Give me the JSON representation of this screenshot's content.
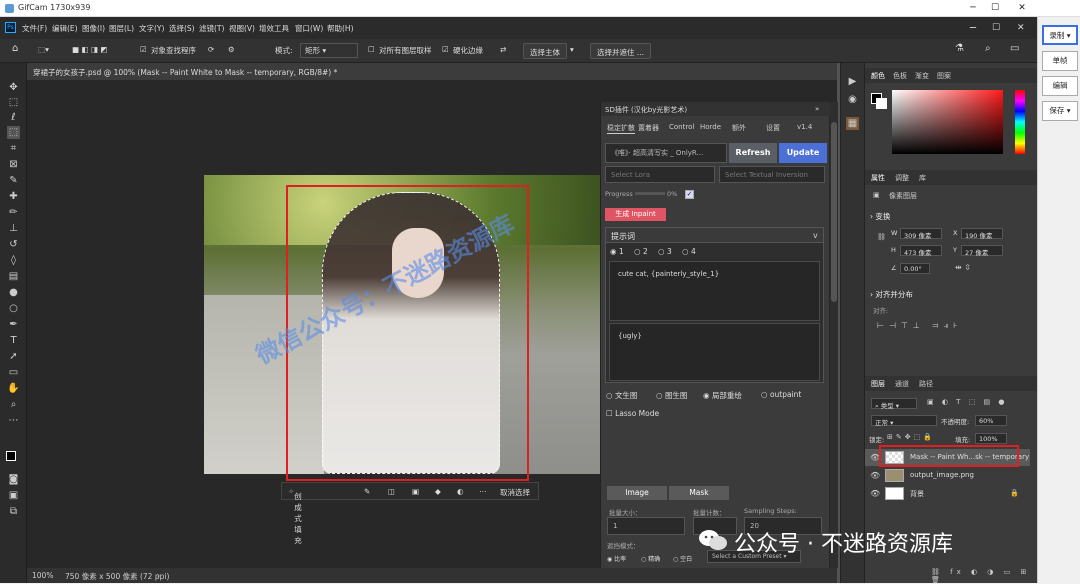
{
  "gifcam": {
    "title": "GifCam 1730x939",
    "buttons": [
      "录制",
      "单帧",
      "编辑",
      "保存"
    ]
  },
  "menu": [
    "文件(F)",
    "编辑(E)",
    "图像(I)",
    "图层(L)",
    "文字(Y)",
    "选择(S)",
    "滤镜(T)",
    "视图(V)",
    "增效工具",
    "窗口(W)",
    "帮助(H)"
  ],
  "options": {
    "auto_select": "对象查找程序",
    "mode_label": "模式:",
    "mode_value": "矩形",
    "sample_all": "对所有图层取样",
    "enhance": "硬化边缘",
    "select_subject": "选择主体",
    "select_and_mask": "选择并遮住 ..."
  },
  "document": {
    "tab": "穿裙子的女孩子.psd @ 100% (Mask -- Paint White to Mask -- temporary, RGB/8#) *",
    "zoom": "100%",
    "size": "750 像素 x 500 像素 (72 ppi)"
  },
  "watermark_canvas": "微信公众号：不迷路资源库",
  "contextbar": {
    "generate": "创成式填充",
    "deselect": "取消选择"
  },
  "sd": {
    "title": "SD插件 (汉化by光影艺术)",
    "tabs": [
      "稳定扩散",
      "置着器",
      "Control",
      "Horde",
      "额外",
      "设置",
      "v1.4"
    ],
    "model": "《唯》· 超高清写实 _ OnlyR...",
    "refresh": "Refresh",
    "update": "Update",
    "lora": "Select Lora",
    "embedding": "Select Textual Inversion",
    "progress_label": "Progress",
    "progress_pct": "0%",
    "generate": "生成 Inpaint",
    "prompt_header": "提示词",
    "prompt_tabs": [
      "1",
      "2",
      "3",
      "4"
    ],
    "prompt_text": "cute cat, {painterly_style_1}",
    "negative_text": "{ugly}",
    "modes": [
      "文生图",
      "图生图",
      "局部重绘",
      "outpaint"
    ],
    "lasso": "Lasso Mode",
    "image_btn": "Image",
    "mask_btn": "Mask",
    "batch_size_label": "批量大小：",
    "batch_size": "1",
    "batch_count_label": "批量计数：",
    "steps_label": "Sampling Steps:",
    "steps": "20",
    "mask_mode_label": "遮挡模式：",
    "mask_opts": [
      "比率",
      "精确",
      "空白"
    ],
    "preset": "Select a Custom Preset"
  },
  "right": {
    "color_tabs": [
      "颜色",
      "色板",
      "渐变",
      "图案"
    ],
    "props_tabs": [
      "属性",
      "调整",
      "库"
    ],
    "pixel_layer": "像素图层",
    "transform": "变换",
    "w": "309 像素",
    "x": "190 像素",
    "h": "473 像素",
    "y": "27 像素",
    "angle": "0.00°",
    "align": "对齐并分布",
    "align_sub": "对齐:",
    "layers_tabs": [
      "图层",
      "通道",
      "路径"
    ],
    "filter": "类型",
    "blend": "正常",
    "opacity_label": "不透明度:",
    "opacity": "60%",
    "lock_label": "锁定:",
    "fill_label": "填充:",
    "fill": "100%",
    "layers": [
      "Mask -- Paint Wh...sk -- temporary",
      "output_image.png",
      "背景"
    ]
  },
  "wechat": "公众号 · 不迷路资源库"
}
